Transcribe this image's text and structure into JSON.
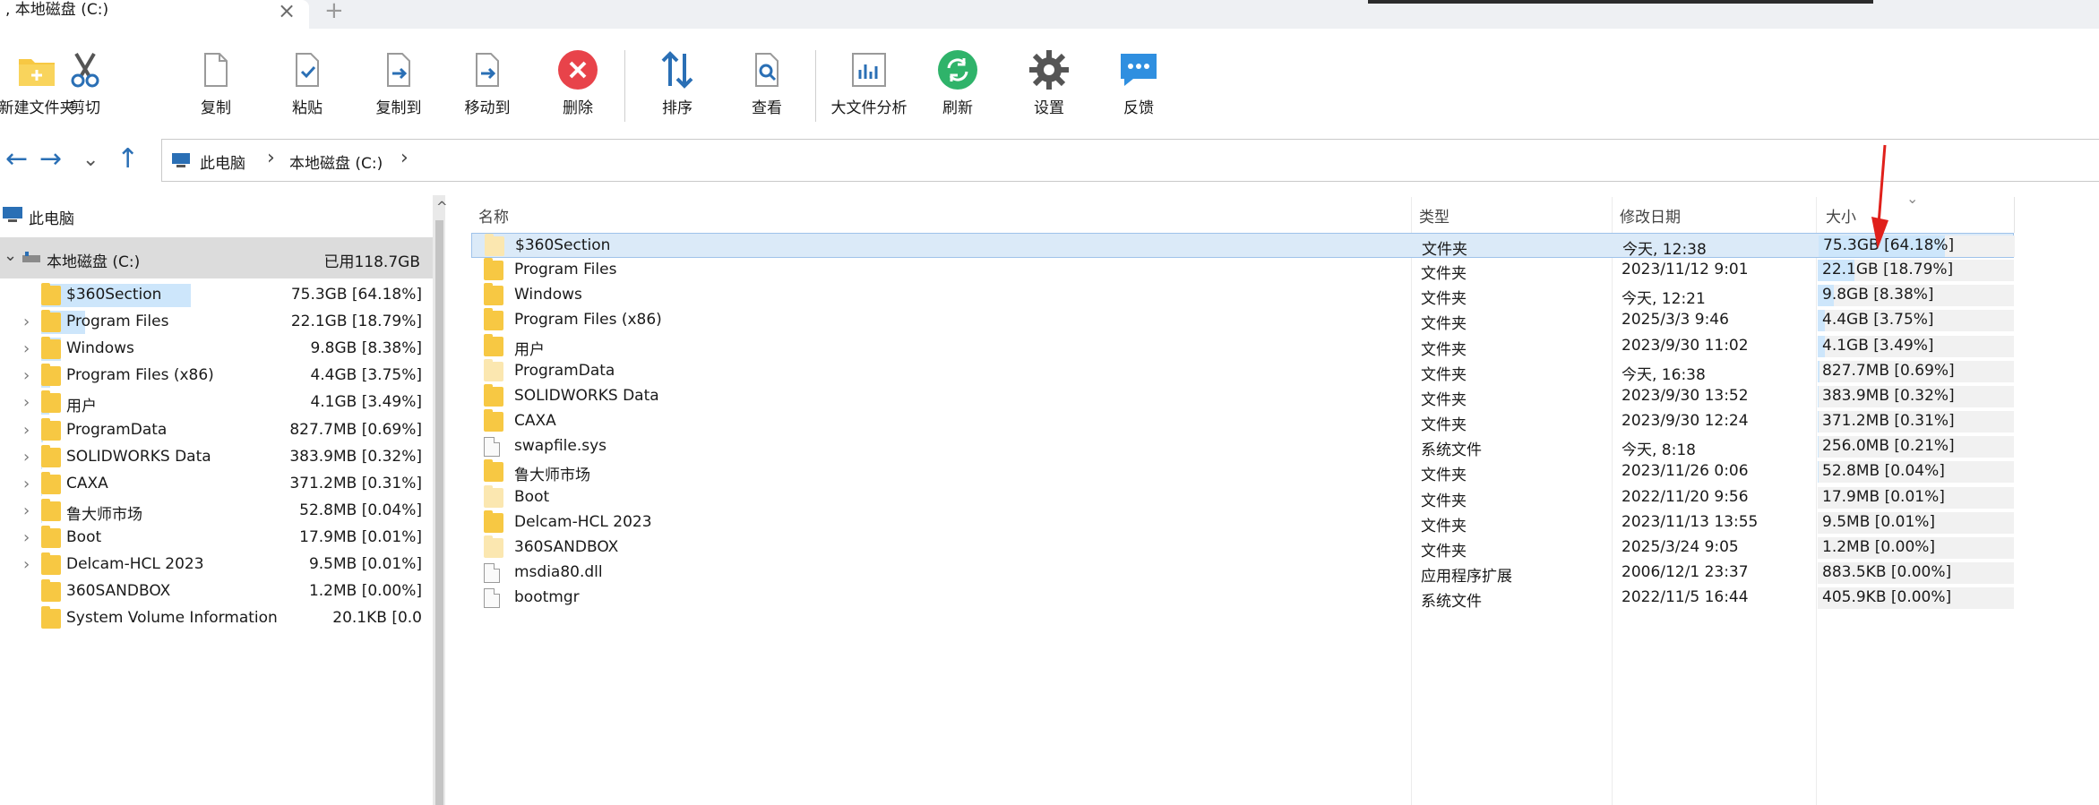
{
  "tab": {
    "title": ", 本地磁盘 (C:)",
    "close": "×",
    "new": "+"
  },
  "toolbar": {
    "new_folder": "新建文件夹",
    "cut": "剪切",
    "copy": "复制",
    "paste": "粘贴",
    "copy_to": "复制到",
    "move_to": "移动到",
    "delete": "删除",
    "sort": "排序",
    "view": "查看",
    "analysis": "大文件分析",
    "refresh": "刷新",
    "settings": "设置",
    "feedback": "反馈"
  },
  "nav": {
    "back": "←",
    "forward": "→",
    "dropdown": "⌄",
    "up": "↑"
  },
  "address": {
    "pc": "此电脑",
    "sep1": "›",
    "drive": "本地磁盘 (C:)",
    "sep2": "›"
  },
  "tree": {
    "pc_label": "此电脑",
    "drive": {
      "expander": "⌄",
      "label": "本地磁盘 (C:)",
      "used": "已用118.7GB"
    },
    "items": [
      {
        "name": "$360Section",
        "size": "75.3GB [64.18%]",
        "pct": 64.18,
        "expandable": false
      },
      {
        "name": "Program Files",
        "size": "22.1GB [18.79%]",
        "pct": 18.79,
        "expandable": true
      },
      {
        "name": "Windows",
        "size": "9.8GB [8.38%]",
        "pct": 8.38,
        "expandable": true
      },
      {
        "name": "Program Files (x86)",
        "size": "4.4GB [3.75%]",
        "pct": 3.75,
        "expandable": true
      },
      {
        "name": "用户",
        "size": "4.1GB [3.49%]",
        "pct": 3.49,
        "expandable": true
      },
      {
        "name": "ProgramData",
        "size": "827.7MB [0.69%]",
        "pct": 0.69,
        "expandable": true
      },
      {
        "name": "SOLIDWORKS Data",
        "size": "383.9MB [0.32%]",
        "pct": 0.32,
        "expandable": true
      },
      {
        "name": "CAXA",
        "size": "371.2MB [0.31%]",
        "pct": 0.31,
        "expandable": true
      },
      {
        "name": "鲁大师市场",
        "size": "52.8MB [0.04%]",
        "pct": 0.04,
        "expandable": true
      },
      {
        "name": "Boot",
        "size": "17.9MB [0.01%]",
        "pct": 0.01,
        "expandable": true
      },
      {
        "name": "Delcam-HCL 2023",
        "size": "9.5MB [0.01%]",
        "pct": 0.01,
        "expandable": true
      },
      {
        "name": "360SANDBOX",
        "size": "1.2MB [0.00%]",
        "pct": 0.0,
        "expandable": false
      },
      {
        "name": "System Volume Information",
        "size": "20.1KB [0.0",
        "pct": 0.0,
        "expandable": false
      }
    ]
  },
  "columns": {
    "name": "名称",
    "type": "类型",
    "date": "修改日期",
    "size": "大小",
    "sort_indicator": "⌄"
  },
  "files": [
    {
      "name": "$360Section",
      "type": "文件夹",
      "date": "今天, 12:38",
      "size": "75.3GB [64.18%]",
      "pct": 64.18,
      "kind": "folder-light"
    },
    {
      "name": "Program Files",
      "type": "文件夹",
      "date": "2023/11/12 9:01",
      "size": "22.1GB [18.79%]",
      "pct": 18.79,
      "kind": "folder"
    },
    {
      "name": "Windows",
      "type": "文件夹",
      "date": "今天, 12:21",
      "size": "9.8GB [8.38%]",
      "pct": 8.38,
      "kind": "folder"
    },
    {
      "name": "Program Files (x86)",
      "type": "文件夹",
      "date": "2025/3/3 9:46",
      "size": "4.4GB [3.75%]",
      "pct": 3.75,
      "kind": "folder"
    },
    {
      "name": "用户",
      "type": "文件夹",
      "date": "2023/9/30 11:02",
      "size": "4.1GB [3.49%]",
      "pct": 3.49,
      "kind": "folder"
    },
    {
      "name": "ProgramData",
      "type": "文件夹",
      "date": "今天, 16:38",
      "size": "827.7MB [0.69%]",
      "pct": 0.69,
      "kind": "folder-light"
    },
    {
      "name": "SOLIDWORKS Data",
      "type": "文件夹",
      "date": "2023/9/30 13:52",
      "size": "383.9MB [0.32%]",
      "pct": 0.32,
      "kind": "folder"
    },
    {
      "name": "CAXA",
      "type": "文件夹",
      "date": "2023/9/30 12:24",
      "size": "371.2MB [0.31%]",
      "pct": 0.31,
      "kind": "folder"
    },
    {
      "name": "swapfile.sys",
      "type": "系统文件",
      "date": "今天, 8:18",
      "size": "256.0MB [0.21%]",
      "pct": 0.21,
      "kind": "file"
    },
    {
      "name": "鲁大师市场",
      "type": "文件夹",
      "date": "2023/11/26 0:06",
      "size": "52.8MB [0.04%]",
      "pct": 0.04,
      "kind": "folder"
    },
    {
      "name": "Boot",
      "type": "文件夹",
      "date": "2022/11/20 9:56",
      "size": "17.9MB [0.01%]",
      "pct": 0.01,
      "kind": "folder-light"
    },
    {
      "name": "Delcam-HCL 2023",
      "type": "文件夹",
      "date": "2023/11/13 13:55",
      "size": "9.5MB [0.01%]",
      "pct": 0.01,
      "kind": "folder"
    },
    {
      "name": "360SANDBOX",
      "type": "文件夹",
      "date": "2025/3/24 9:05",
      "size": "1.2MB [0.00%]",
      "pct": 0.0,
      "kind": "folder-light"
    },
    {
      "name": "msdia80.dll",
      "type": "应用程序扩展",
      "date": "2006/12/1 23:37",
      "size": "883.5KB [0.00%]",
      "pct": 0.0,
      "kind": "file"
    },
    {
      "name": "bootmgr",
      "type": "系统文件",
      "date": "2022/11/5 16:44",
      "size": "405.9KB [0.00%]",
      "pct": 0.0,
      "kind": "file"
    }
  ],
  "colors": {
    "accent": "#2a6fb5",
    "selection": "#dbeaf8",
    "size_bar": "#cde6fb",
    "folder": "#f7c843",
    "delete": "#e8434a",
    "refresh": "#2fb36a",
    "feedback": "#2f8fe0",
    "annotation": "#e0201b"
  }
}
